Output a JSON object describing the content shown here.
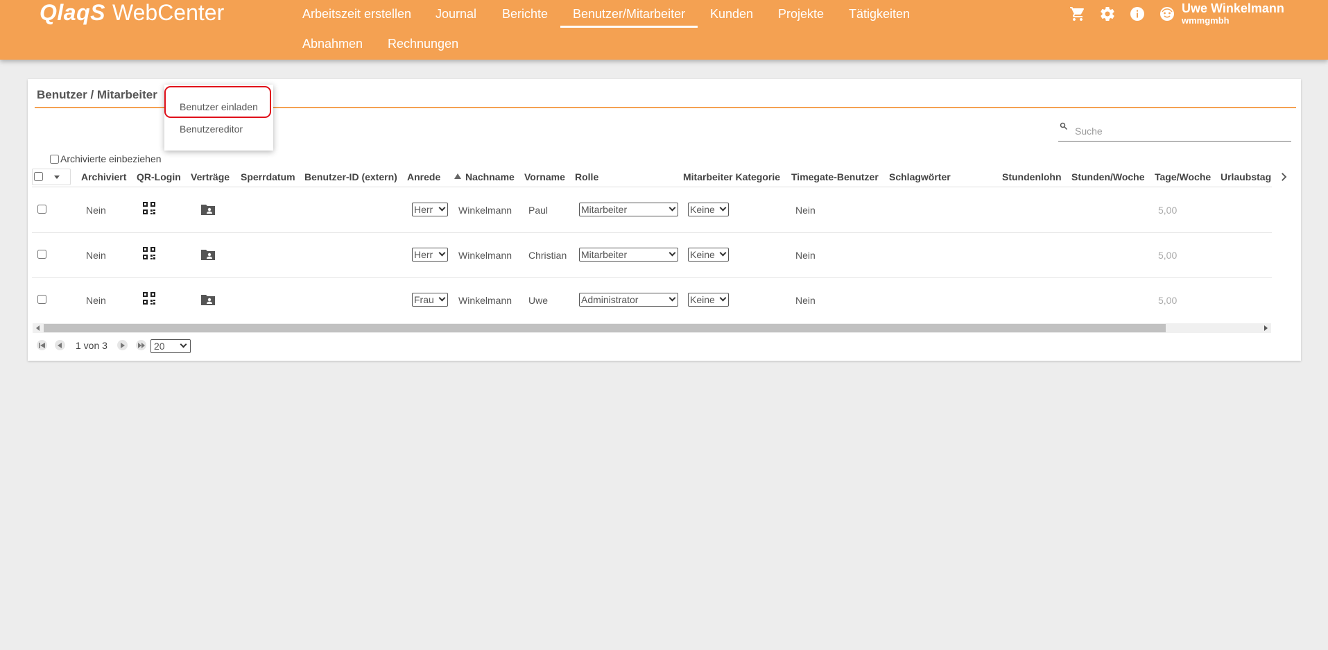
{
  "header": {
    "logo_brand": "QlaqS",
    "logo_product": "WebCenter",
    "nav": [
      {
        "label": "Arbeitszeit erstellen"
      },
      {
        "label": "Journal"
      },
      {
        "label": "Berichte"
      },
      {
        "label": "Benutzer/Mitarbeiter",
        "active": true
      },
      {
        "label": "Kunden"
      },
      {
        "label": "Projekte"
      },
      {
        "label": "Tätigkeiten"
      },
      {
        "label": "Abnahmen"
      },
      {
        "label": "Rechnungen"
      }
    ],
    "icons": [
      "cart-icon",
      "gear-icon",
      "info-icon",
      "user-avatar-icon"
    ],
    "user_name": "Uwe Winkelmann",
    "user_company": "wmmgmbh"
  },
  "card": {
    "title": "Benutzer / Mitarbeiter",
    "menu": [
      "Benutzer einladen",
      "Benutzereditor"
    ],
    "search_placeholder": "Suche",
    "archived_label": "Archivierte einbeziehen"
  },
  "table": {
    "columns": [
      "Archiviert",
      "QR-Login",
      "Verträge",
      "Sperrdatum",
      "Benutzer-ID (extern)",
      "Anrede",
      "Nachname",
      "Vorname",
      "Rolle",
      "Mitarbeiter Kategorie",
      "Timegate-Benutzer",
      "Schlagwörter",
      "Stundenlohn",
      "Stunden/Woche",
      "Tage/Woche",
      "Urlaubstag"
    ],
    "rows": [
      {
        "archiviert": "Nein",
        "anrede": "Herr",
        "nachname": "Winkelmann",
        "vorname": "Paul",
        "rolle": "Mitarbeiter",
        "kategorie": "Keine",
        "timegate": "Nein",
        "tage_woche": "5,00"
      },
      {
        "archiviert": "Nein",
        "anrede": "Herr",
        "nachname": "Winkelmann",
        "vorname": "Christian",
        "rolle": "Mitarbeiter",
        "kategorie": "Keine",
        "timegate": "Nein",
        "tage_woche": "5,00"
      },
      {
        "archiviert": "Nein",
        "anrede": "Frau",
        "nachname": "Winkelmann",
        "vorname": "Uwe",
        "rolle": "Administrator",
        "kategorie": "Keine",
        "timegate": "Nein",
        "tage_woche": "5,00"
      }
    ]
  },
  "pager": {
    "text": "1 von 3",
    "page_size": "20"
  },
  "colors": {
    "header_bg": "#f4a152",
    "accent": "#f4a152",
    "highlight": "#e0101a"
  }
}
